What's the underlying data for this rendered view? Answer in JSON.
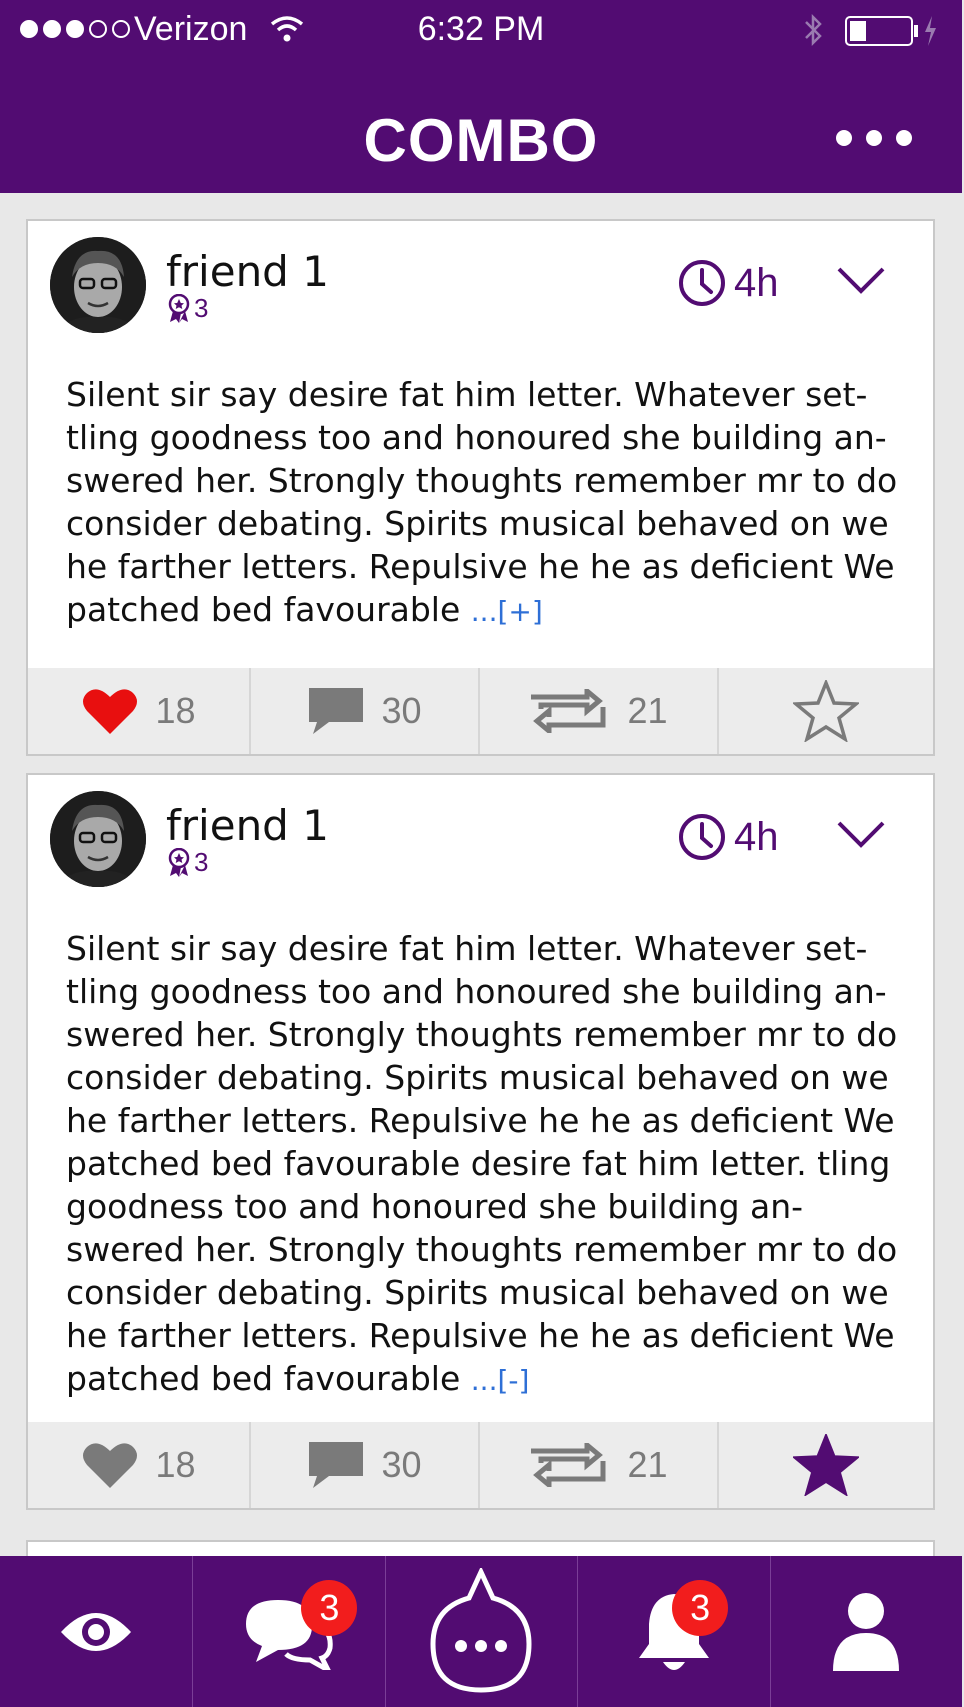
{
  "status_bar": {
    "carrier": "Verizon",
    "time": "6:32 PM"
  },
  "header": {
    "title": "COMBO"
  },
  "posts": [
    {
      "author": "friend 1",
      "rank": "3",
      "age": "4h",
      "text": "Silent sir say desire fat him letter. Whatever set-tling goodness too and honoured she building an-swered her. Strongly thoughts remember mr to do consider debating. Spirits musical behaved on we he farther letters. Repulsive he he as deficient We patched bed favourable",
      "expand_label": "...[+]",
      "likes": "18",
      "comments": "30",
      "reposts": "21",
      "liked": true,
      "starred": false
    },
    {
      "author": "friend 1",
      "rank": "3",
      "age": "4h",
      "text": "Silent sir say desire fat him letter. Whatever set-tling goodness too and honoured she building an-swered her. Strongly thoughts remember mr to do consider debating. Spirits musical behaved on we he farther letters. Repulsive he he as deficient We patched bed favourable desire fat him letter. tling goodness too and honoured she building an-swered her. Strongly thoughts remember mr to do consider debating. Spirits musical behaved on we he farther letters. Repulsive he he as deficient We patched bed favourable",
      "expand_label": "...[-]",
      "likes": "18",
      "comments": "30",
      "reposts": "21",
      "liked": false,
      "starred": true
    }
  ],
  "tabbar": {
    "messages_badge": "3",
    "notifications_badge": "3"
  },
  "colors": {
    "brand": "#520c72",
    "like": "#e80f0f",
    "link": "#2e6fd6",
    "badge": "#f21d1d"
  },
  "icons": [
    "eye-icon",
    "chat-icon",
    "compose-bubble-icon",
    "bell-icon",
    "person-icon",
    "clock-icon",
    "chevron-down-icon",
    "heart-icon",
    "comment-icon",
    "repost-icon",
    "star-icon",
    "rank-medal-icon"
  ]
}
